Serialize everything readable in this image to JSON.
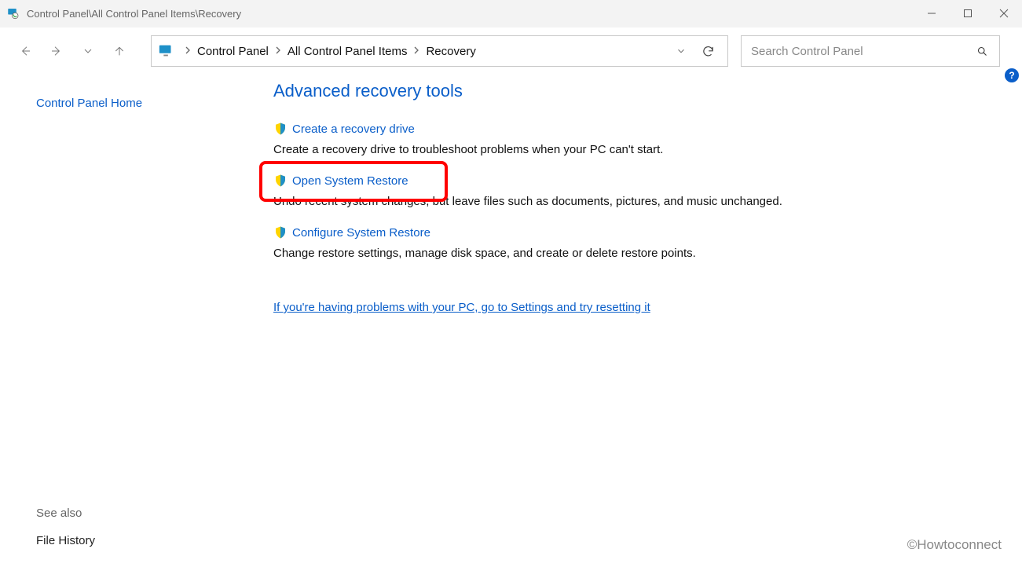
{
  "window": {
    "title": "Control Panel\\All Control Panel Items\\Recovery"
  },
  "address": {
    "seg1": "Control Panel",
    "seg2": "All Control Panel Items",
    "seg3": "Recovery"
  },
  "search": {
    "placeholder": "Search Control Panel"
  },
  "sidebar": {
    "home": "Control Panel Home",
    "see_also": "See also",
    "file_history": "File History"
  },
  "content": {
    "heading": "Advanced recovery tools",
    "items": [
      {
        "title": "Create a recovery drive",
        "desc": "Create a recovery drive to troubleshoot problems when your PC can't start."
      },
      {
        "title": "Open System Restore",
        "desc": "Undo recent system changes, but leave files such as documents, pictures, and music unchanged."
      },
      {
        "title": "Configure System Restore",
        "desc": "Change restore settings, manage disk space, and create or delete restore points."
      }
    ],
    "more": "If you're having problems with your PC, go to Settings and try resetting it"
  },
  "watermark": "©Howtoconnect",
  "help": "?"
}
